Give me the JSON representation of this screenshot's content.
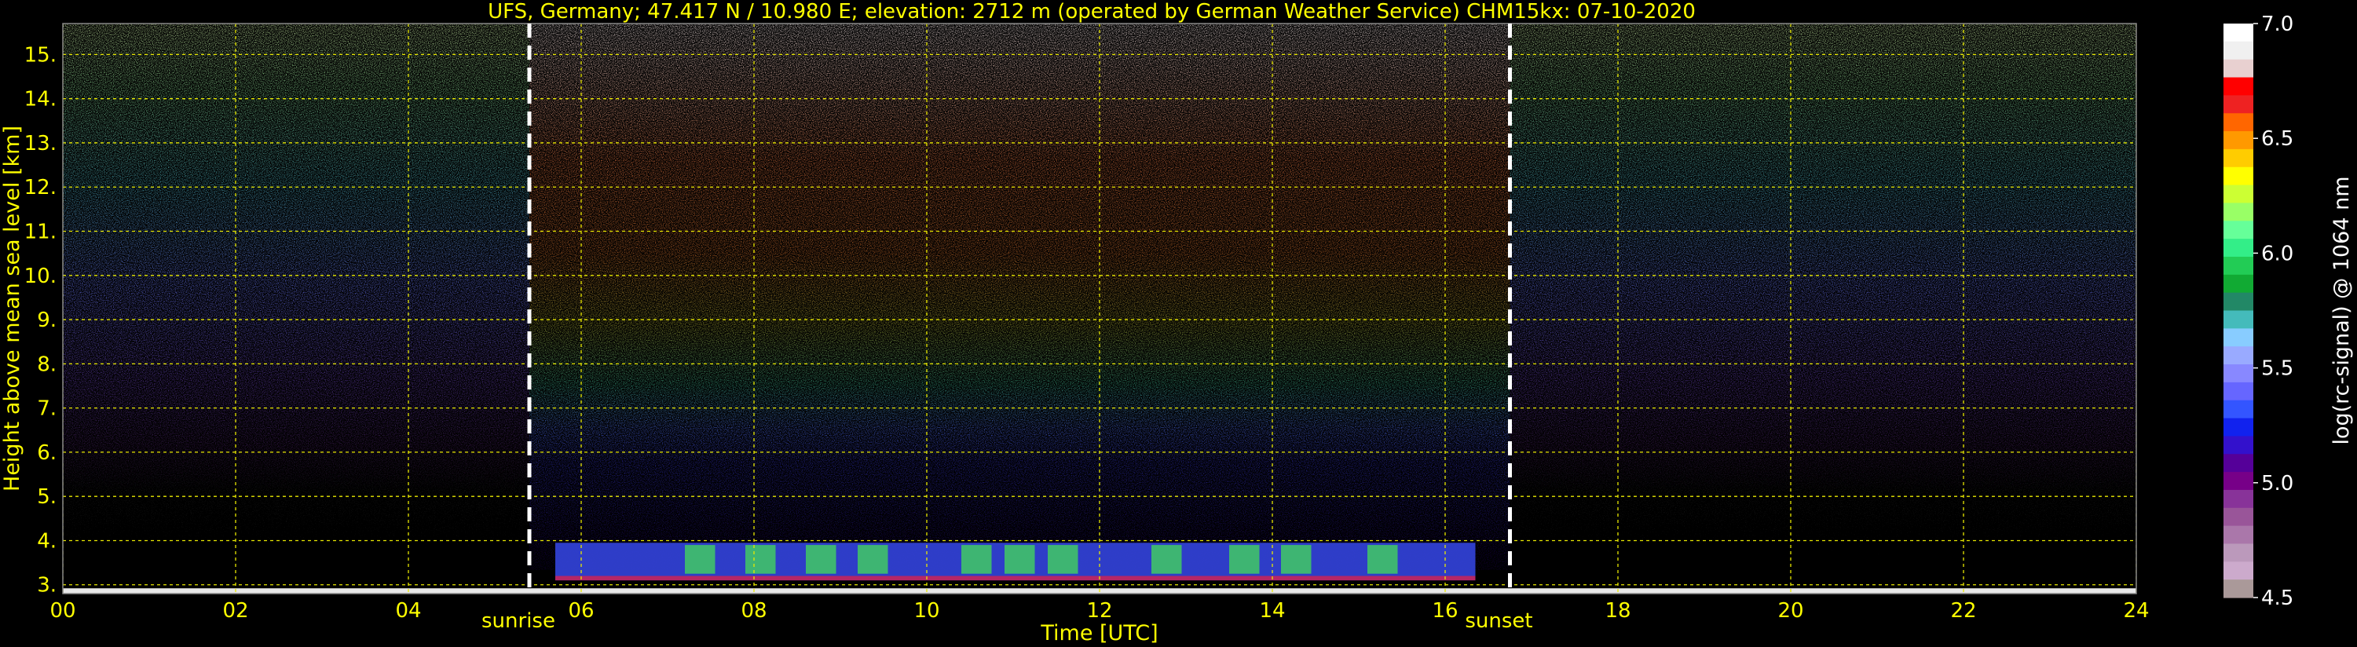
{
  "chart_data": {
    "type": "heatmap",
    "title": "UFS, Germany; 47.417 N / 10.980 E; elevation: 2712 m  (operated by German Weather Service)    CHM15kx: 07-10-2020",
    "xlabel": "Time [UTC]",
    "ylabel": "Height above mean sea level [km]",
    "xlim": [
      0,
      24
    ],
    "ylim": [
      2.8,
      15.7
    ],
    "x_ticks": [
      "00",
      "02",
      "04",
      "06",
      "08",
      "10",
      "12",
      "14",
      "16",
      "18",
      "20",
      "22",
      "24"
    ],
    "y_ticks": [
      "3.",
      "4.",
      "5.",
      "6.",
      "7.",
      "8.",
      "9.",
      "10.",
      "11.",
      "12.",
      "13.",
      "14.",
      "15."
    ],
    "grid": true,
    "annotations": [
      {
        "label": "sunrise",
        "x": 5.4
      },
      {
        "label": "sunset",
        "x": 16.75
      }
    ],
    "colorbar": {
      "label": "log(rc-signal) @ 1064 nm",
      "range": [
        4.5,
        7.0
      ],
      "ticks": [
        "7.0",
        "6.5",
        "6.0",
        "5.5",
        "5.0",
        "4.5"
      ],
      "colors": [
        "#ffffff",
        "#f0f0f0",
        "#e8d0d0",
        "#ff0000",
        "#ee2222",
        "#ff6600",
        "#ff9900",
        "#ffcc00",
        "#ffff00",
        "#ccff33",
        "#99ff66",
        "#66ff99",
        "#33ee88",
        "#22cc55",
        "#11aa33",
        "#228866",
        "#44bbbb",
        "#88ccff",
        "#99aaff",
        "#8888ff",
        "#6666ff",
        "#3355ff",
        "#1122ee",
        "#3311cc",
        "#550099",
        "#770088",
        "#883399",
        "#995599",
        "#aa77aa",
        "#bb99bb",
        "#ccaacc",
        "#aa9999"
      ]
    }
  }
}
